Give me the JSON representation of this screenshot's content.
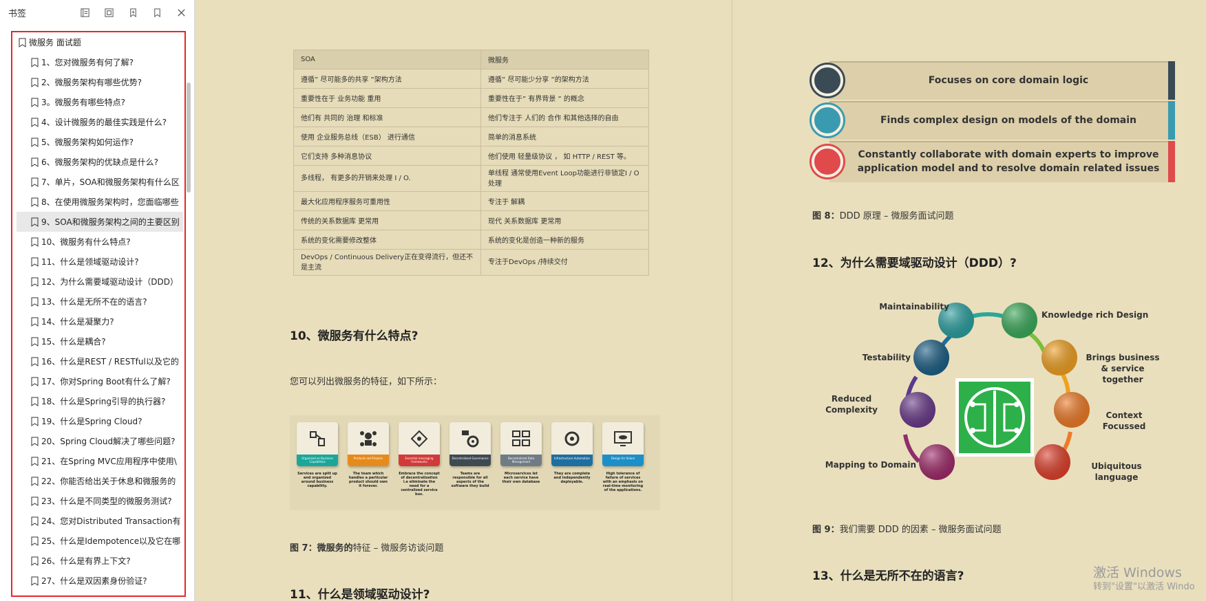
{
  "sidebar": {
    "title": "书签",
    "root_label": "微服务 面试题",
    "items": [
      "1、您对微服务有何了解?",
      "2、微服务架构有哪些优势?",
      "3。微服务有哪些特点?",
      "4、设计微服务的最佳实践是什么?",
      "5、微服务架构如何运作?",
      "6、微服务架构的优缺点是什么?",
      "7、单片，SOA和微服务架构有什么区",
      "8、在使用微服务架构时，您面临哪些",
      "9、SOA和微服务架构之间的主要区别",
      "10、微服务有什么特点?",
      "11、什么是领域驱动设计?",
      "12、为什么需要域驱动设计（DDD）",
      "13、什么是无所不在的语言?",
      "14、什么是凝聚力?",
      "15、什么是耦合?",
      "16、什么是REST / RESTful以及它的",
      "17、你对Spring Boot有什么了解?",
      "18、什么是Spring引导的执行器?",
      "19、什么是Spring Cloud?",
      "20、Spring Cloud解决了哪些问题?",
      "21、在Spring MVC应用程序中使用\\",
      "22、你能否给出关于休息和微服务的",
      "23、什么是不同类型的微服务测试?",
      "24、您对Distributed Transaction有",
      "25、什么是Idempotence以及它在哪",
      "26、什么是有界上下文?",
      "27、什么是双因素身份验证?"
    ],
    "selected_index": 8
  },
  "table": {
    "headers": [
      "SOA",
      "微服务"
    ],
    "rows": [
      [
        "遵循” 尽可能多的共享 ”架构方法",
        "遵循” 尽可能少分享 ”的架构方法"
      ],
      [
        "重要性在于  业务功能  重用",
        "重要性在于” 有界背景 ” 的概念"
      ],
      [
        "他们有  共同的 治理  和标准",
        "他们专注于  人们的  合作  和其他选择的自由"
      ],
      [
        "使用  企业服务总线（ESB）  进行通信",
        "简单的消息系统"
      ],
      [
        "它们支持  多种消息协议",
        "他们使用  轻量级协议  ， 如  HTTP / REST  等。"
      ],
      [
        "多线程，  有更多的开销来处理 I / O.",
        "单线程  通常使用Event Loop功能进行非锁定I / O处理"
      ],
      [
        "最大化应用程序服务可重用性",
        "专注于  解耦"
      ],
      [
        "传统的关系数据库  更常用",
        "现代  关系数据库  更常用"
      ],
      [
        "系统的变化需要修改整体",
        "系统的变化是创造一种新的服务"
      ],
      [
        "DevOps / Continuous Delivery正在变得流行，但还不是主流",
        "专注于DevOps /持续交付"
      ]
    ]
  },
  "left_page": {
    "heading_10": "10、微服务有什么特点?",
    "para_10": "您可以列出微服务的特征，如下所示：",
    "caption_7_bold": "图 7：微服务的",
    "caption_7_rest": "特征  –  微服务访谈问题",
    "heading_11": "11、什么是领域驱动设计?"
  },
  "features": [
    {
      "band": "Organized on Business Capabilities",
      "desc": "Services are split up and organized around business capability.",
      "color": "#1aa79a",
      "icon": "org-icon"
    },
    {
      "band": "Products not Projects",
      "desc": "The team which handles a particular product should own it forever.",
      "color": "#e78a1c",
      "icon": "people-icon"
    },
    {
      "band": "Essential messaging frameworks",
      "desc": "Embrace the concept of decentralization i.e eliminate the need for a centralized service bus.",
      "color": "#d23a3a",
      "icon": "network-icon"
    },
    {
      "band": "Decentralized Governance",
      "desc": "Teams are responsible for all aspects of the software they build",
      "color": "#3e4a52",
      "icon": "gear-icon"
    },
    {
      "band": "Decentralized Data Management",
      "desc": "Microservices let each service have their own database",
      "color": "#6f7c86",
      "icon": "database-icon"
    },
    {
      "band": "Infrastructure Automation",
      "desc": "They are complete and independently deployable.",
      "color": "#1e6fa0",
      "icon": "automation-icon"
    },
    {
      "band": "Design for failure",
      "desc": "High tolerance of failure of services with an emphasis on real-time monitoring of the applications.",
      "color": "#1c8fc8",
      "icon": "monitor-icon"
    }
  ],
  "right_page": {
    "principles": [
      {
        "text": "Focuses on core domain logic",
        "color": "#3b4b55"
      },
      {
        "text": "Finds complex design on models of the domain",
        "color": "#3a9bb0"
      },
      {
        "text": "Constantly collaborate with domain experts to improve application model and to resolve domain related issues",
        "color": "#e04a4a"
      }
    ],
    "caption_8_bold": "图 8：",
    "caption_8_rest": "DDD 原理  –  微服务面试问题",
    "heading_12": "12、为什么需要域驱动设计（DDD）?",
    "factors": {
      "maintainability": "Maintainability",
      "knowledge": "Knowledge rich Design",
      "testability": "Testability",
      "brings": "Brings  business & service together",
      "reduced": "Reduced Complexity",
      "context": "Context Focussed",
      "mapping": "Mapping to Domain",
      "ubiquitous": "Ubiquitous language"
    },
    "caption_9_bold": "图 9：",
    "caption_9_rest": "我们需要 DDD 的因素  –  微服务面试问题",
    "heading_13": "13、什么是无所不在的语言?"
  },
  "watermark": {
    "line1": "激活 Windows",
    "line2": "转到\"设置\"以激活 Windo"
  }
}
